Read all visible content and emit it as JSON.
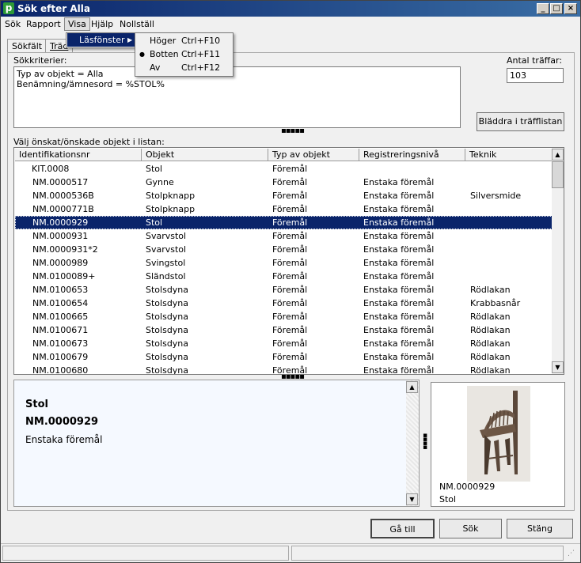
{
  "window": {
    "title": "Sök efter Alla",
    "app_icon": "p"
  },
  "menubar": [
    "Sök",
    "Rapport",
    "Visa",
    "Hjälp",
    "Nollställ"
  ],
  "visa_menu": {
    "item": "Läsfönster",
    "arrow": "▶"
  },
  "lasfonster_submenu": [
    {
      "label": "Höger",
      "shortcut": "Ctrl+F10",
      "checked": false
    },
    {
      "label": "Botten",
      "shortcut": "Ctrl+F11",
      "checked": true
    },
    {
      "label": "Av",
      "shortcut": "Ctrl+F12",
      "checked": false
    }
  ],
  "tabs": [
    "Sökfält",
    "Träd"
  ],
  "criteria": {
    "label": "Sökkriterier:",
    "lines": [
      "Typ av objekt = Alla",
      "Benämning/ämnesord = %STOL%"
    ]
  },
  "hits": {
    "label": "Antal träffar:",
    "value": "103"
  },
  "browse_button": "Bläddra i träfflistan",
  "list_label": "Välj önskat/önskade objekt i listan:",
  "columns": [
    "Identifikationsnr",
    "Objekt",
    "Typ av objekt",
    "Registreringsnivå",
    "Teknik"
  ],
  "rows": [
    [
      "KIT.0008",
      "Stol",
      "Föremål",
      "",
      ""
    ],
    [
      "NM.0000517",
      "Gynne",
      "Föremål",
      "Enstaka föremål",
      ""
    ],
    [
      "NM.0000536B",
      "Stolpknapp",
      "Föremål",
      "Enstaka föremål",
      "Silversmide"
    ],
    [
      "NM.0000771B",
      "Stolpknapp",
      "Föremål",
      "Enstaka föremål",
      ""
    ],
    [
      "NM.0000929",
      "Stol",
      "Föremål",
      "Enstaka föremål",
      ""
    ],
    [
      "NM.0000931",
      "Svarvstol",
      "Föremål",
      "Enstaka föremål",
      ""
    ],
    [
      "NM.0000931*2",
      "Svarvstol",
      "Föremål",
      "Enstaka föremål",
      ""
    ],
    [
      "NM.0000989",
      "Svingstol",
      "Föremål",
      "Enstaka föremål",
      ""
    ],
    [
      "NM.0100089+",
      "Sländstol",
      "Föremål",
      "Enstaka föremål",
      ""
    ],
    [
      "NM.0100653",
      "Stolsdyna",
      "Föremål",
      "Enstaka föremål",
      "Rödlakan"
    ],
    [
      "NM.0100654",
      "Stolsdyna",
      "Föremål",
      "Enstaka föremål",
      "Krabbasnår"
    ],
    [
      "NM.0100665",
      "Stolsdyna",
      "Föremål",
      "Enstaka föremål",
      "Rödlakan"
    ],
    [
      "NM.0100671",
      "Stolsdyna",
      "Föremål",
      "Enstaka föremål",
      "Rödlakan"
    ],
    [
      "NM.0100673",
      "Stolsdyna",
      "Föremål",
      "Enstaka föremål",
      "Rödlakan"
    ],
    [
      "NM.0100679",
      "Stolsdyna",
      "Föremål",
      "Enstaka föremål",
      "Rödlakan"
    ],
    [
      "NM.0100680",
      "Stolsdyna",
      "Föremål",
      "Enstaka föremål",
      "Rödlakan"
    ]
  ],
  "selected_row_index": 4,
  "detail": {
    "title": "Stol",
    "id": "NM.0000929",
    "level": "Enstaka föremål"
  },
  "image_caption": {
    "id": "NM.0000929",
    "name": "Stol"
  },
  "buttons": {
    "goto": "Gå till",
    "search": "Sök",
    "close": "Stäng"
  },
  "colors": {
    "selection": "#0a246a",
    "title_bar": "#0a246a",
    "detail_bg": "#f5f9ff"
  }
}
